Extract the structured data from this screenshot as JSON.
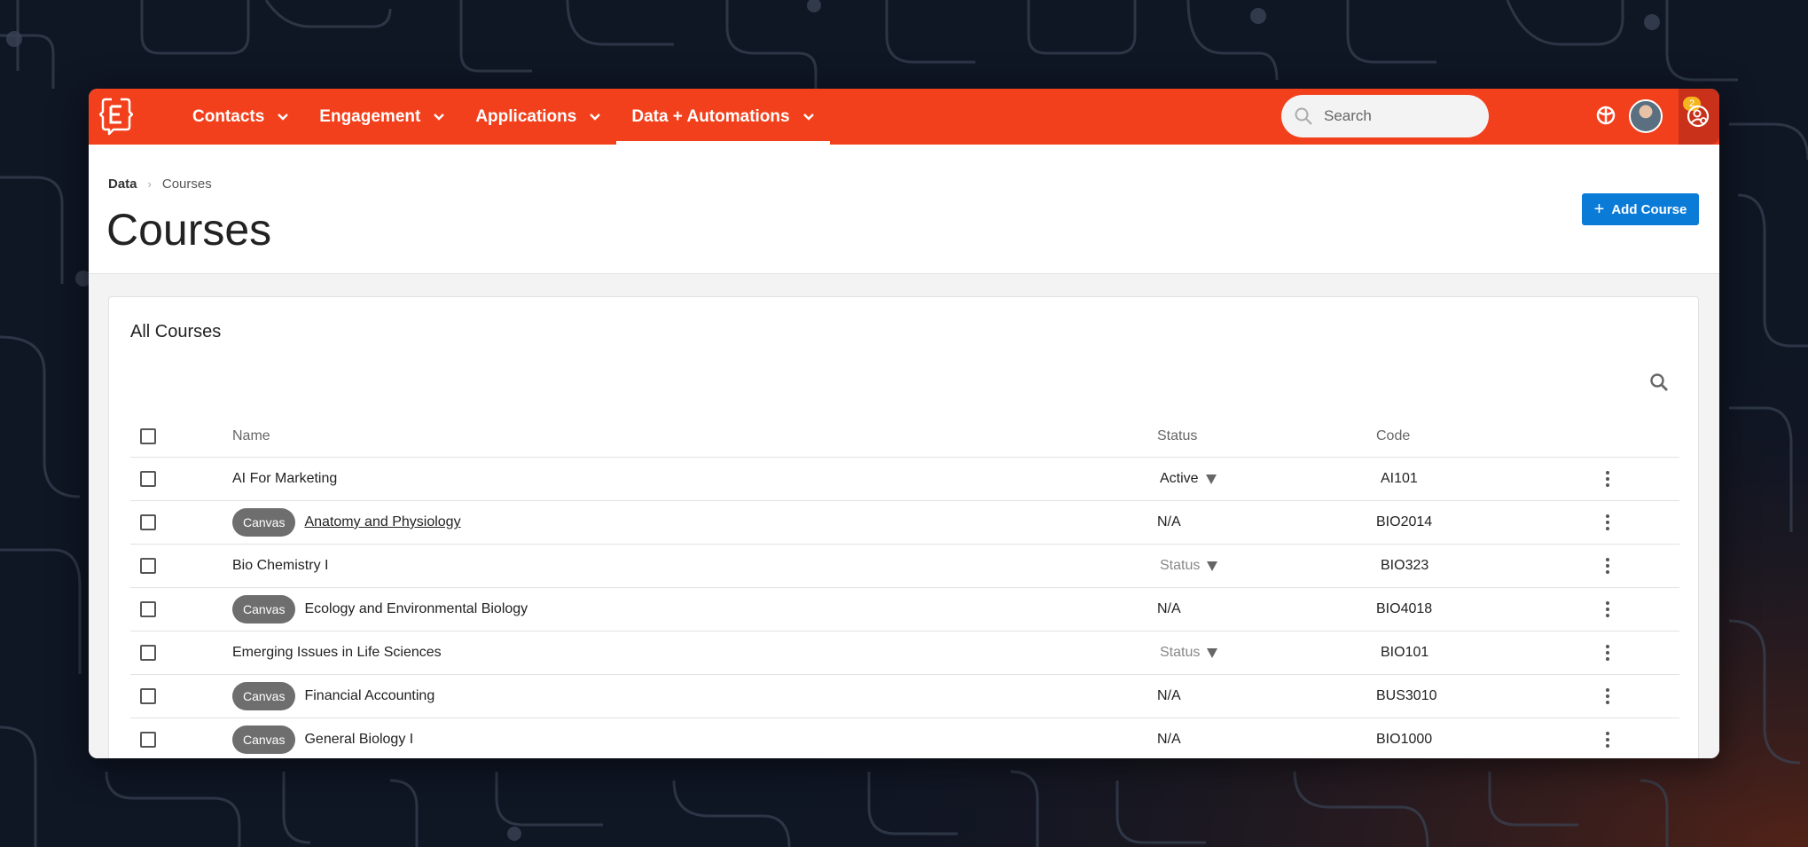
{
  "nav": {
    "items": [
      {
        "label": "Contacts",
        "active": false
      },
      {
        "label": "Engagement",
        "active": false
      },
      {
        "label": "Applications",
        "active": false
      },
      {
        "label": "Data + Automations",
        "active": true
      }
    ],
    "search_placeholder": "Search",
    "notification_count": "2",
    "icons": [
      "logo-icon",
      "chat-icon",
      "tasks-icon",
      "help-icon",
      "avatar",
      "account-icon"
    ]
  },
  "breadcrumb": {
    "root": "Data",
    "current": "Courses"
  },
  "page": {
    "title": "Courses",
    "add_button": "Add Course"
  },
  "table": {
    "title": "All Courses",
    "columns": {
      "name": "Name",
      "status": "Status",
      "code": "Code"
    },
    "rows": [
      {
        "tag": "",
        "name": "AI For Marketing",
        "link": false,
        "status": "Active",
        "status_type": "dropdown",
        "code": "AI101"
      },
      {
        "tag": "Canvas",
        "name": "Anatomy and Physiology",
        "link": true,
        "status": "N/A",
        "status_type": "text",
        "code": "BIO2014"
      },
      {
        "tag": "",
        "name": "Bio Chemistry I",
        "link": false,
        "status": "Status",
        "status_type": "placeholder",
        "code": "BIO323"
      },
      {
        "tag": "Canvas",
        "name": "Ecology and Environmental Biology",
        "link": false,
        "status": "N/A",
        "status_type": "text",
        "code": "BIO4018"
      },
      {
        "tag": "",
        "name": "Emerging Issues in Life Sciences",
        "link": false,
        "status": "Status",
        "status_type": "placeholder",
        "code": "BIO101"
      },
      {
        "tag": "Canvas",
        "name": "Financial Accounting",
        "link": false,
        "status": "N/A",
        "status_type": "text",
        "code": "BUS3010"
      },
      {
        "tag": "Canvas",
        "name": "General Biology I",
        "link": false,
        "status": "N/A",
        "status_type": "text",
        "code": "BIO1000"
      }
    ]
  },
  "colors": {
    "brand": "#f2401c",
    "primary_button": "#0b7bd8",
    "tag": "#6e6e6e",
    "badge": "#f6b51e"
  }
}
